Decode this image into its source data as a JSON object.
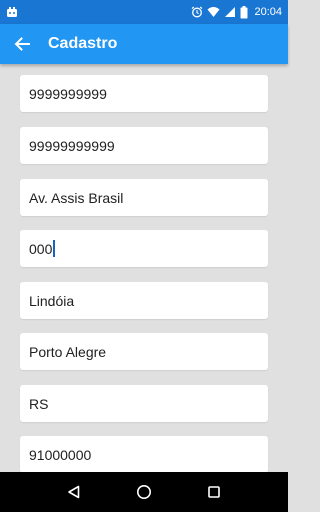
{
  "status_bar": {
    "time": "20:04",
    "icons": [
      "notification-icon",
      "alarm-icon",
      "wifi-icon",
      "signal-icon",
      "battery-icon"
    ]
  },
  "app_bar": {
    "title": "Cadastro",
    "back_icon": "arrow-back-icon"
  },
  "fields": [
    {
      "value": "9999999999"
    },
    {
      "value": "99999999999"
    },
    {
      "value": "Av. Assis Brasil"
    },
    {
      "value": "000",
      "focused": true
    },
    {
      "value": "Lindóia"
    },
    {
      "value": "Porto Alegre"
    },
    {
      "value": "RS"
    },
    {
      "value": "91000000"
    }
  ],
  "nav_bar": {
    "icons": [
      "back-triangle-icon",
      "home-circle-icon",
      "recents-square-icon"
    ]
  },
  "colors": {
    "status_bar": "#1976d2",
    "app_bar": "#2196f3",
    "background": "#e0e0e0",
    "cursor": "#1565c0"
  }
}
